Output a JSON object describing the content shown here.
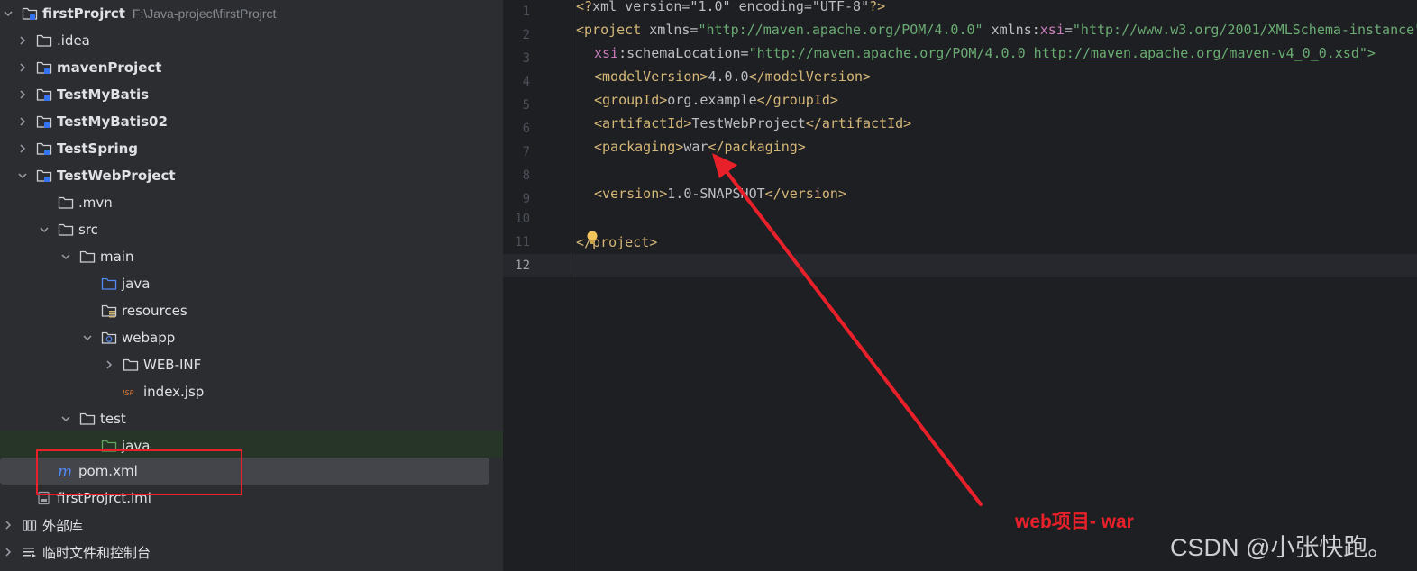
{
  "tree": {
    "rows": [
      {
        "label": "firstProjrct",
        "path": "F:\\Java-project\\firstProjrct",
        "icon": "module-folder-icon"
      },
      {
        "label": ".idea",
        "icon": "folder-icon"
      },
      {
        "label": "mavenProject",
        "icon": "module-folder-icon"
      },
      {
        "label": "TestMyBatis",
        "icon": "module-folder-icon"
      },
      {
        "label": "TestMyBatis02",
        "icon": "module-folder-icon"
      },
      {
        "label": "TestSpring",
        "icon": "module-folder-icon"
      },
      {
        "label": "TestWebProject",
        "icon": "module-folder-icon"
      },
      {
        "label": ".mvn",
        "icon": "folder-icon"
      },
      {
        "label": "src",
        "icon": "folder-icon"
      },
      {
        "label": "main",
        "icon": "folder-icon"
      },
      {
        "label": "java",
        "icon": "source-folder-icon"
      },
      {
        "label": "resources",
        "icon": "resources-folder-icon"
      },
      {
        "label": "webapp",
        "icon": "web-folder-icon"
      },
      {
        "label": "WEB-INF",
        "icon": "folder-icon"
      },
      {
        "label": "index.jsp",
        "icon": "jsp-file-icon"
      },
      {
        "label": "test",
        "icon": "folder-icon"
      },
      {
        "label": "java",
        "icon": "test-source-folder-icon"
      },
      {
        "label": "pom.xml",
        "icon": "maven-file-icon"
      },
      {
        "label": "firstProjrct.iml",
        "icon": "iml-file-icon"
      },
      {
        "label": "外部库",
        "icon": "library-icon"
      },
      {
        "label": "临时文件和控制台",
        "icon": "scratches-icon"
      }
    ]
  },
  "editor": {
    "line_numbers": [
      "1",
      "2",
      "3",
      "4",
      "5",
      "6",
      "7",
      "8",
      "9",
      "10",
      "11",
      "12"
    ],
    "lines": {
      "l1": {
        "a": "<?",
        "b": "xml version=\"1.0\" encoding=\"UTF-8\"",
        "c": "?>"
      },
      "l2": {
        "tag": "<project",
        "attr1": " xmlns=",
        "val1": "\"http://maven.apache.org/POM/4.0.0\"",
        "attr2": " xmlns:",
        "ns": "xsi",
        "eq": "=",
        "val2": "\"http://www.w3.org/2001/XMLSchema-instance\""
      },
      "l3": {
        "ns": "xsi",
        "attr": ":schemaLocation=",
        "val1": "\"http://maven.apache.org/POM/4.0.0 ",
        "link": "http://maven.apache.org/maven-v4_0_0.xsd",
        "val2": "\">"
      },
      "l4": {
        "open": "<modelVersion>",
        "text": "4.0.0",
        "close": "</modelVersion>"
      },
      "l5": {
        "open": "<groupId>",
        "text": "org.example",
        "close": "</groupId>"
      },
      "l6": {
        "open": "<artifactId>",
        "text": "TestWebProject",
        "close": "</artifactId>"
      },
      "l7": {
        "open": "<packaging>",
        "text": "war",
        "close": "</packaging>"
      },
      "l9": {
        "open": "<version>",
        "text": "1.0-SNAPSHOT",
        "close": "</version>"
      },
      "l11": {
        "close": "</project>"
      }
    }
  },
  "annotation": {
    "text": "web项目- war"
  },
  "watermark": {
    "text": "CSDN @小张快跑。"
  },
  "colors": {
    "annotation": "#e8202a",
    "tag": "#d5b778",
    "string": "#6aab73",
    "namespace": "#c77dbb"
  }
}
